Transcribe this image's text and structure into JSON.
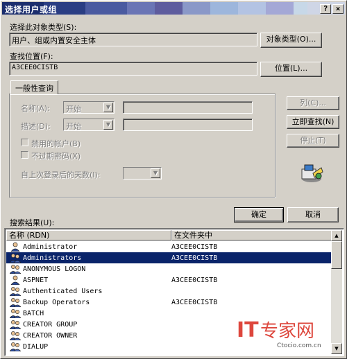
{
  "window": {
    "title": "选择用户或组",
    "help_button": "?",
    "close_button": "×"
  },
  "object_type": {
    "label": "选择此对象类型(S):",
    "value": "用户、组或内置安全主体",
    "button": "对象类型(O)..."
  },
  "location": {
    "label": "查找位置(F):",
    "value": "A3CEE0CISTB",
    "button": "位置(L)..."
  },
  "query": {
    "tab": "一般性查询",
    "name_label": "名称(A):",
    "name_mode": "开始",
    "desc_label": "描述(D):",
    "desc_mode": "开始",
    "disabled_accounts": "禁用的帐户(B)",
    "no_expire_password": "不过期密码(X)",
    "days_since_logon": "自上次登录后的天数(I):"
  },
  "side_buttons": {
    "columns": "列(C)...",
    "find_now": "立即查找(N)",
    "stop": "停止(T)"
  },
  "dialog_buttons": {
    "ok": "确定",
    "cancel": "取消"
  },
  "results": {
    "label": "搜索结果(U):",
    "columns": [
      "名称 (RDN)",
      "在文件夹中"
    ],
    "rows": [
      {
        "name": "Administrator",
        "folder": "A3CEE0CISTB",
        "icon": "user-icon"
      },
      {
        "name": "Administrators",
        "folder": "A3CEE0CISTB",
        "icon": "group-icon",
        "selected": true
      },
      {
        "name": "ANONYMOUS LOGON",
        "folder": "",
        "icon": "group-icon"
      },
      {
        "name": "ASPNET",
        "folder": "A3CEE0CISTB",
        "icon": "user-icon"
      },
      {
        "name": "Authenticated Users",
        "folder": "",
        "icon": "group-icon"
      },
      {
        "name": "Backup Operators",
        "folder": "A3CEE0CISTB",
        "icon": "group-icon"
      },
      {
        "name": "BATCH",
        "folder": "",
        "icon": "group-icon"
      },
      {
        "name": "CREATOR GROUP",
        "folder": "",
        "icon": "group-icon"
      },
      {
        "name": "CREATOR OWNER",
        "folder": "",
        "icon": "group-icon"
      },
      {
        "name": "DIALUP",
        "folder": "",
        "icon": "group-icon"
      }
    ]
  },
  "watermark": {
    "brand": "IT专家网",
    "site": "Ctocio.com.cn"
  },
  "colors": {
    "selection": "#0a246a",
    "face": "#d4d0c8",
    "watermark_red": "#d8281c"
  }
}
